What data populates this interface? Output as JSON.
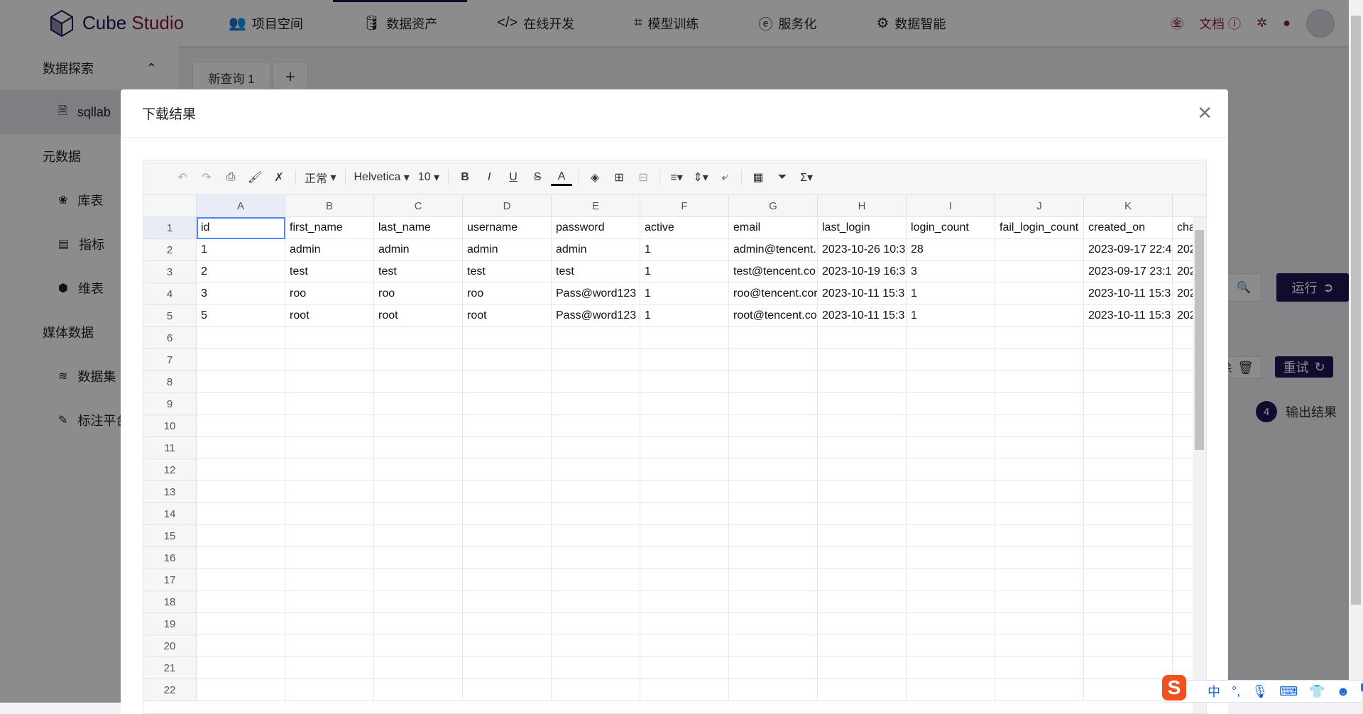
{
  "header": {
    "brand_a": "Cube",
    "brand_b": " Studio",
    "nav": [
      {
        "icon": "users-icon",
        "glyph": "👥",
        "label": "项目空间"
      },
      {
        "icon": "database-icon",
        "glyph": "🛢",
        "label": "数据资产",
        "active": true
      },
      {
        "icon": "code-icon",
        "glyph": "</>",
        "label": "在线开发"
      },
      {
        "icon": "training-icon",
        "glyph": "⌗",
        "label": "模型训练"
      },
      {
        "icon": "service-icon",
        "glyph": "ⓔ",
        "label": "服务化"
      },
      {
        "icon": "ai-icon",
        "glyph": "⚙",
        "label": "数据智能"
      }
    ],
    "docs_label": "文档"
  },
  "sidebar": {
    "groups": [
      {
        "label": "数据探索",
        "items": [
          {
            "label": "sqllab",
            "glyph": "🗎",
            "icon": "sql-file-icon",
            "active": true
          }
        ]
      },
      {
        "label": "元数据",
        "items": [
          {
            "label": "库表",
            "glyph": "❀",
            "icon": "table-icon"
          },
          {
            "label": "指标",
            "glyph": "▤",
            "icon": "metric-icon"
          },
          {
            "label": "维表",
            "glyph": "⬢",
            "icon": "dimension-icon"
          }
        ]
      },
      {
        "label": "媒体数据",
        "items": [
          {
            "label": "数据集",
            "glyph": "≋",
            "icon": "dataset-icon"
          },
          {
            "label": "标注平台",
            "glyph": "✎",
            "icon": "label-icon"
          }
        ]
      }
    ]
  },
  "background": {
    "query_tab": "新查询 1",
    "add_tab": "+",
    "run": "运行",
    "delete_fragment": "除",
    "retry": "重试",
    "step_number": "4",
    "step_label": "输出结果"
  },
  "modal": {
    "title": "下载结果",
    "toolbar": {
      "format": "正常",
      "font": "Helvetica",
      "font_size": "10"
    },
    "columns": [
      "A",
      "B",
      "C",
      "D",
      "E",
      "F",
      "G",
      "H",
      "I",
      "J",
      "K",
      ""
    ],
    "rows": [
      [
        "id",
        "first_name",
        "last_name",
        "username",
        "password",
        "active",
        "email",
        "last_login",
        "login_count",
        "fail_login_count",
        "created_on",
        "cha"
      ],
      [
        "1",
        "admin",
        "admin",
        "admin",
        "admin",
        "1",
        "admin@tencent.",
        "2023-10-26 10:3",
        "28",
        "",
        "2023-09-17 22:4",
        "202"
      ],
      [
        "2",
        "test",
        "test",
        "test",
        "test",
        "1",
        "test@tencent.co",
        "2023-10-19 16:3",
        "3",
        "",
        "2023-09-17 23:1",
        "202"
      ],
      [
        "3",
        "roo",
        "roo",
        "roo",
        "Pass@word123",
        "1",
        "roo@tencent.cor",
        "2023-10-11 15:3",
        "1",
        "",
        "2023-10-11 15:3",
        "202"
      ],
      [
        "5",
        "root",
        "root",
        "root",
        "Pass@word123",
        "1",
        "root@tencent.co",
        "2023-10-11 15:3",
        "1",
        "",
        "2023-10-11 15:3",
        "202"
      ]
    ],
    "row_count": 22
  },
  "ime": {
    "lang": "中",
    "punct": "°,"
  },
  "colors": {
    "brand": "#1e1653",
    "accent": "#8a1c3c",
    "selection": "#4b89ff"
  }
}
